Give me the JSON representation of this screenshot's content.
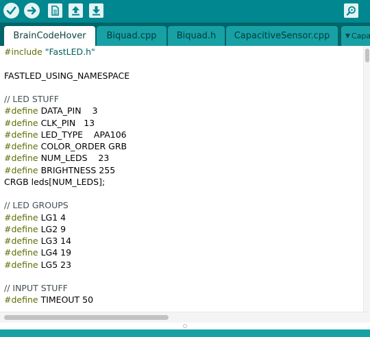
{
  "toolbar": {
    "buttons": [
      {
        "name": "verify-button",
        "icon": "checkmark-icon"
      },
      {
        "name": "upload-button",
        "icon": "arrow-right-icon"
      },
      {
        "name": "new-button",
        "icon": "new-file-icon"
      },
      {
        "name": "open-button",
        "icon": "arrow-up-icon"
      },
      {
        "name": "save-button",
        "icon": "arrow-down-icon"
      },
      {
        "name": "serial-monitor-button",
        "icon": "magnifier-icon"
      }
    ]
  },
  "tabs": [
    {
      "label": "BrainCodeHover",
      "active": true
    },
    {
      "label": "Biquad.cpp",
      "active": false
    },
    {
      "label": "Biquad.h",
      "active": false
    },
    {
      "label": "CapacitiveSensor.cpp",
      "active": false
    }
  ],
  "tab_overflow": {
    "icon": "dropdown-arrow-icon",
    "label": "Capa"
  },
  "code": {
    "lines": [
      {
        "t1": "#include",
        "t2": " ",
        "t3": "\"FastLED.h\""
      },
      {
        "t1": "",
        "t2": "",
        "t3": ""
      },
      {
        "t1": "",
        "t2": "FASTLED_USING_NAMESPACE",
        "t3": ""
      },
      {
        "t1": "",
        "t2": "",
        "t3": ""
      },
      {
        "t1": "// LED STUFF",
        "t2": "",
        "t3": ""
      },
      {
        "t1": "#define",
        "t2": " DATA_PIN    3",
        "t3": ""
      },
      {
        "t1": "#define",
        "t2": " CLK_PIN   13",
        "t3": ""
      },
      {
        "t1": "#define",
        "t2": " LED_TYPE    APA106",
        "t3": ""
      },
      {
        "t1": "#define",
        "t2": " COLOR_ORDER GRB",
        "t3": ""
      },
      {
        "t1": "#define",
        "t2": " NUM_LEDS    23",
        "t3": ""
      },
      {
        "t1": "#define",
        "t2": " BRIGHTNESS 255",
        "t3": ""
      },
      {
        "t1": "",
        "t2": "CRGB leds[NUM_LEDS];",
        "t3": ""
      },
      {
        "t1": "",
        "t2": "",
        "t3": ""
      },
      {
        "t1": "// LED GROUPS",
        "t2": "",
        "t3": ""
      },
      {
        "t1": "#define",
        "t2": " LG1 4",
        "t3": ""
      },
      {
        "t1": "#define",
        "t2": " LG2 9",
        "t3": ""
      },
      {
        "t1": "#define",
        "t2": " LG3 14",
        "t3": ""
      },
      {
        "t1": "#define",
        "t2": " LG4 19",
        "t3": ""
      },
      {
        "t1": "#define",
        "t2": " LG5 23",
        "t3": ""
      },
      {
        "t1": "",
        "t2": "",
        "t3": ""
      },
      {
        "t1": "// INPUT STUFF",
        "t2": "",
        "t3": ""
      },
      {
        "t1": "#define",
        "t2": " TIMEOUT 50",
        "t3": ""
      }
    ]
  },
  "colors": {
    "toolbar": "#00878f",
    "tabbar": "#006468",
    "tab_inactive": "#17a1a5",
    "keyword": "#5e6d03",
    "string": "#005c5f",
    "comment": "#434f54"
  }
}
